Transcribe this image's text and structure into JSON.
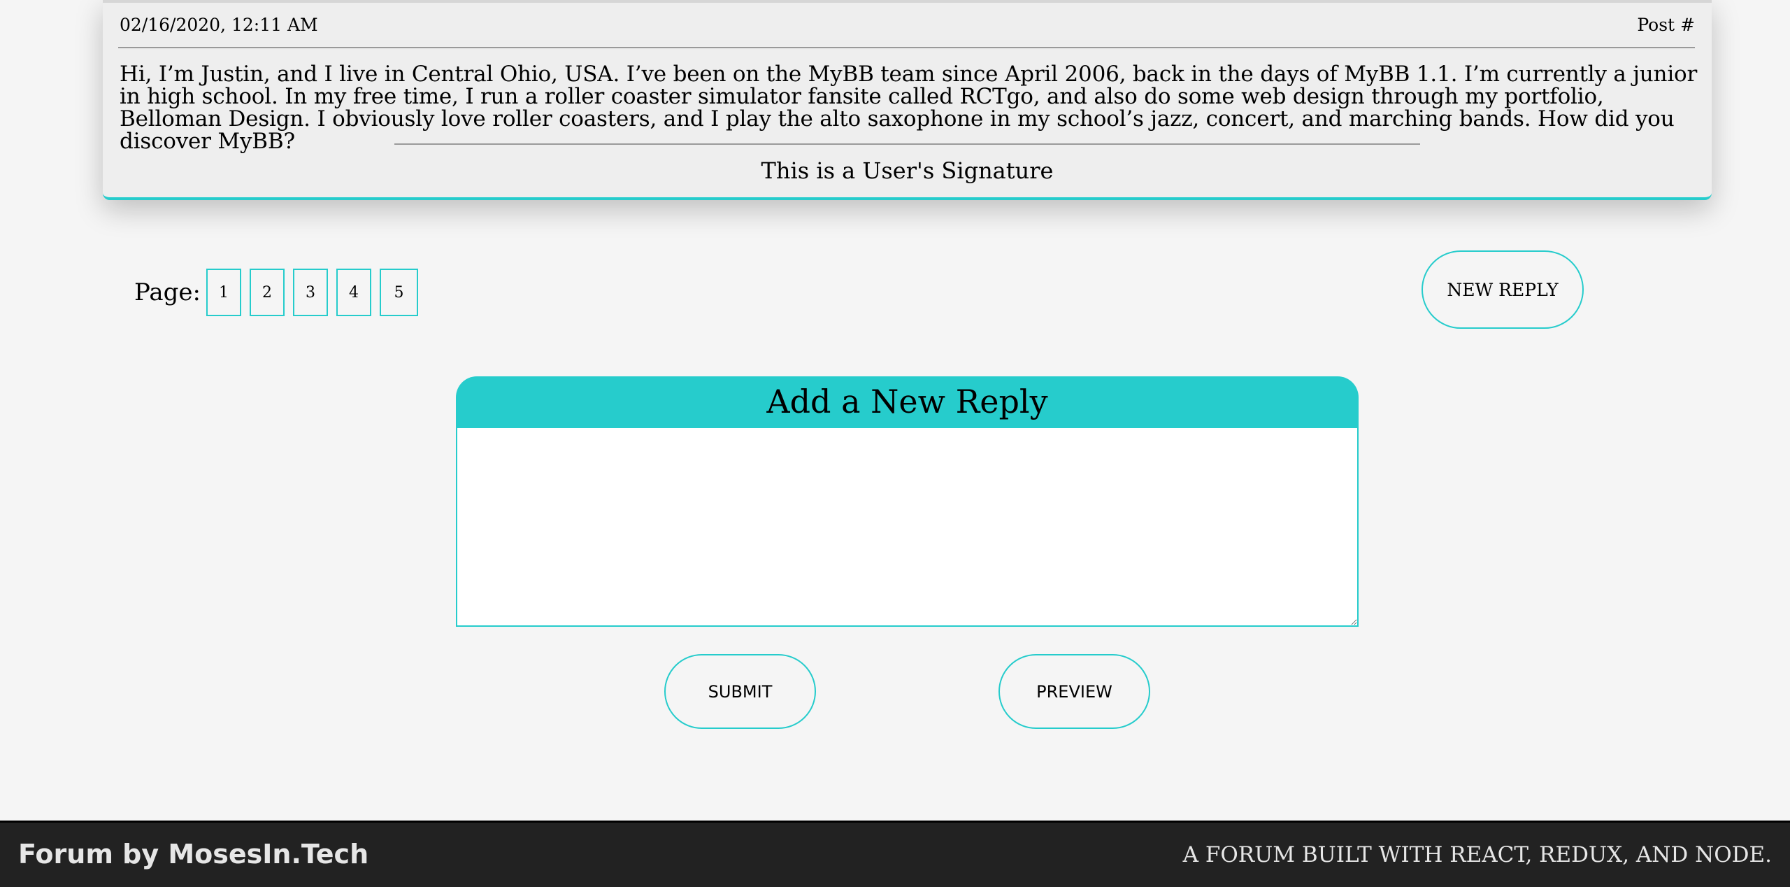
{
  "post": {
    "date": "02/16/2020, 12:11 AM",
    "post_number": "Post #",
    "body": "Hi, I’m Justin, and I live in Central Ohio, USA. I’ve been on the MyBB team since April 2006, back in the days of MyBB 1.1. I’m currently a junior in high school. In my free time, I run a roller coaster simulator fansite called RCTgo, and also do some web design through my portfolio, Belloman Design. I obviously love roller coasters, and I play the alto saxophone in my school’s jazz, concert, and marching bands. How did you discover MyBB?",
    "signature": "This is a User's Signature"
  },
  "pagination": {
    "label": "Page:",
    "pages": [
      "1",
      "2",
      "3",
      "4",
      "5"
    ]
  },
  "new_reply_button": "NEW REPLY",
  "reply_form": {
    "title": "Add a New Reply",
    "textarea_value": "",
    "submit_label": "SUBMIT",
    "preview_label": "PREVIEW"
  },
  "footer": {
    "brand": "Forum by MosesIn.Tech",
    "tagline": "A FORUM BUILT WITH REACT, REDUX, AND NODE."
  },
  "colors": {
    "accent": "#26cccc",
    "background": "#f5f5f5",
    "card": "#eeeeee",
    "footer": "#222222"
  }
}
